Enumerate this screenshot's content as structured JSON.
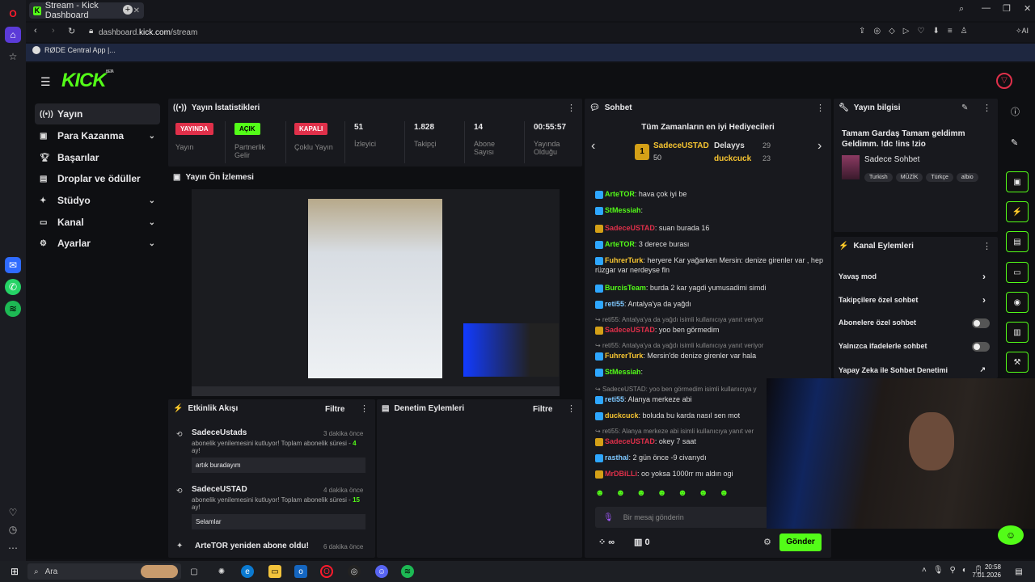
{
  "browser": {
    "tab_title": "Stream - Kick Dashboard",
    "url_plain": "dashboard.",
    "url_bold": "kick.com",
    "url_path": "/stream",
    "bookmark": "RØDE Central App |...",
    "ai_label": "AI"
  },
  "logo": {
    "text": "KICK",
    "beta": "BETA"
  },
  "sidebar": {
    "items": [
      {
        "label": "Yayın"
      },
      {
        "label": "Para Kazanma"
      },
      {
        "label": "Başarılar"
      },
      {
        "label": "Droplar ve ödüller"
      },
      {
        "label": "Stüdyo"
      },
      {
        "label": "Kanal"
      },
      {
        "label": "Ayarlar"
      }
    ]
  },
  "stats": {
    "title": "Yayın İstatistikleri",
    "live_badge": "YAYINDA",
    "live_label": "Yayın",
    "partner_badge": "AÇIK",
    "partner_label": "Partnerlik Gelir",
    "multi_badge": "KAPALI",
    "multi_label": "Çoklu Yayın",
    "viewers": "51",
    "viewers_label": "İzleyici",
    "followers": "1.828",
    "followers_label": "Takipçi",
    "subs": "14",
    "subs_label": "Abone Sayısı",
    "uptime": "00:55:57",
    "uptime_label": "Yayında Olduğu"
  },
  "preview": {
    "title": "Yayın Ön İzlemesi"
  },
  "activity": {
    "title": "Etkinlik Akışı",
    "filter": "Filtre",
    "items": [
      {
        "user": "SadeceUstads",
        "time": "3 dakika önce",
        "text": "abonelik yenilemesini kutluyor! Toplam abonelik süresi -",
        "months": "4",
        "unit": "ay!",
        "msg": "artık buradayım"
      },
      {
        "user": "SadeceUSTAD",
        "time": "4 dakika önce",
        "text": "abonelik yenilemesini kutluyor! Toplam abonelik süresi -",
        "months": "15",
        "unit": "ay!",
        "msg": "Selamlar"
      },
      {
        "user": "ArteTOR yeniden abone oldu!",
        "time": "6 dakika önce"
      }
    ]
  },
  "moderation": {
    "title": "Denetim Eylemleri",
    "filter": "Filtre"
  },
  "chat": {
    "title": "Sohbet",
    "gifters_title": "Tüm Zamanların en iyi Hediyecileri",
    "top1_name": "SadeceUSTAD",
    "top1_count": "50",
    "top2_name": "Delayys",
    "top2_count": "29",
    "top3_name": "duckcuck",
    "top3_count": "23",
    "messages": [
      {
        "user": "ArteTOR",
        "color": "#53fc18",
        "text": ": hava çok iyi be"
      },
      {
        "user": "StMessiah",
        "color": "#53fc18",
        "text": ":"
      },
      {
        "user": "SadeceUSTAD",
        "color": "#e0304a",
        "text": ": suan burada 16"
      },
      {
        "user": "ArteTOR",
        "color": "#53fc18",
        "text": ": 3 derece burası"
      },
      {
        "user": "FuhrerTurk",
        "color": "#f7c531",
        "text": ": heryere Kar yağarken Mersin: denize girenler var , hep rüzgar var nerdeyse fln"
      },
      {
        "user": "BurcisTeam",
        "color": "#53fc18",
        "text": ": burda 2 kar yagdi yumusadimi simdi"
      },
      {
        "user": "reti55",
        "color": "#7ec8ff",
        "text": ": Antalya'ya da yağdı"
      },
      {
        "reply": "reti55: Antalya'ya da yağdı isimli kullanıcıya yanıt veriyor"
      },
      {
        "user": "SadeceUSTAD",
        "color": "#e0304a",
        "text": ": yoo ben görmedim"
      },
      {
        "reply": "reti55: Antalya'ya da yağdı isimli kullanıcıya yanıt veriyor"
      },
      {
        "user": "FuhrerTurk",
        "color": "#f7c531",
        "text": ": Mersin'de denize girenler var hala"
      },
      {
        "user": "StMessiah",
        "color": "#53fc18",
        "text": ":"
      },
      {
        "reply": "SadeceUSTAD: yoo ben görmedim isimli kullanıcıya y"
      },
      {
        "user": "reti55",
        "color": "#7ec8ff",
        "text": ": Alanya merkeze abi"
      },
      {
        "user": "duckcuck",
        "color": "#f7c531",
        "text": ": boluda bu karda nasıl sen mot"
      },
      {
        "reply": "reti55: Alanya merkeze abi isimli kullanıcıya yanıt ver"
      },
      {
        "user": "SadeceUSTAD",
        "color": "#e0304a",
        "text": ": okey 7 saat"
      },
      {
        "user": "rasthal",
        "color": "#7ec8ff",
        "text": ": 2 gün önce -9 civarıydı"
      },
      {
        "user": "MrDBiLLi",
        "color": "#e0304a",
        "text": ": oo yoksa 1000rr mı aldın ogi"
      }
    ],
    "input_placeholder": "Bir mesaj gönderin",
    "infinity": "∞",
    "count": "0",
    "send_label": "Gönder"
  },
  "stream_info": {
    "title": "Yayın bilgisi",
    "stream_title": "Tamam Gardaş Tamam geldimm Geldimm. !dc !ins !zio",
    "category": "Sadece Sohbet",
    "tags": [
      "Turkish",
      "MÜZİK",
      "Türkçe",
      "albio"
    ]
  },
  "channel_actions": {
    "title": "Kanal Eylemleri",
    "items": [
      {
        "label": "Yavaş mod"
      },
      {
        "label": "Takipçilere özel sohbet"
      },
      {
        "label": "Abonelere özel sohbet"
      },
      {
        "label": "Yalnızca ifadelerle sohbet"
      },
      {
        "label": "Yapay Zeka ile Sohbet Denetimi"
      }
    ]
  },
  "taskbar": {
    "search": "Ara",
    "time": "20:58",
    "date": "7.01.2026"
  },
  "colors": {
    "brand": "#53fc18",
    "live": "#e0304a",
    "bg": "#0e0f12",
    "panel": "#18191e"
  }
}
